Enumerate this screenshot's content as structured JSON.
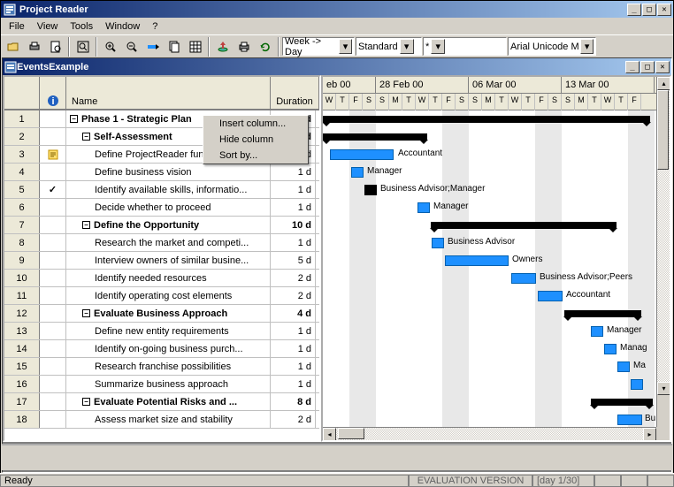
{
  "app": {
    "title": "Project Reader"
  },
  "menus": [
    "File",
    "View",
    "Tools",
    "Window",
    "?"
  ],
  "toolbar": {
    "zoom_combo": "Week -> Day",
    "layout_combo": "Standard",
    "filter_combo": "*",
    "font_combo": "Arial Unicode MS"
  },
  "doc": {
    "title": "EventsExample"
  },
  "columns": {
    "indicator": "",
    "name": "Name",
    "duration": "Duration"
  },
  "context_menu": [
    "Insert column...",
    "Hide column",
    "Sort by..."
  ],
  "timeline_weeks": [
    "eb 00",
    "28 Feb 00",
    "06 Mar 00",
    "13 Mar 00"
  ],
  "timeline_days": [
    "W",
    "T",
    "F",
    "S",
    "S",
    "M",
    "T",
    "W",
    "T",
    "F",
    "S",
    "S",
    "M",
    "T",
    "W",
    "T",
    "F",
    "S",
    "S",
    "M",
    "T",
    "W",
    "T",
    "F"
  ],
  "rows": [
    {
      "n": "1",
      "ind": "",
      "name": "Phase 1 - Strategic Plan",
      "dur": "3 d",
      "bold": true,
      "lvl": 0,
      "out": "-"
    },
    {
      "n": "2",
      "ind": "",
      "name": "Self-Assessment",
      "dur": "5 d",
      "bold": true,
      "lvl": 1,
      "out": "-"
    },
    {
      "n": "3",
      "ind": "note",
      "name": "Define ProjectReader functionalities",
      "dur": "5 d",
      "bold": false,
      "lvl": 2
    },
    {
      "n": "4",
      "ind": "",
      "name": "Define business vision",
      "dur": "1 d",
      "bold": false,
      "lvl": 2
    },
    {
      "n": "5",
      "ind": "check",
      "name": "Identify available skills, informatio...",
      "dur": "1 d",
      "bold": false,
      "lvl": 2
    },
    {
      "n": "6",
      "ind": "",
      "name": "Decide whether to proceed",
      "dur": "1 d",
      "bold": false,
      "lvl": 2
    },
    {
      "n": "7",
      "ind": "",
      "name": "Define the Opportunity",
      "dur": "10 d",
      "bold": true,
      "lvl": 1,
      "out": "-"
    },
    {
      "n": "8",
      "ind": "",
      "name": "Research the market and competi...",
      "dur": "1 d",
      "bold": false,
      "lvl": 2
    },
    {
      "n": "9",
      "ind": "",
      "name": "Interview owners of similar busine...",
      "dur": "5 d",
      "bold": false,
      "lvl": 2
    },
    {
      "n": "10",
      "ind": "",
      "name": "Identify needed resources",
      "dur": "2 d",
      "bold": false,
      "lvl": 2
    },
    {
      "n": "11",
      "ind": "",
      "name": "Identify operating cost elements",
      "dur": "2 d",
      "bold": false,
      "lvl": 2
    },
    {
      "n": "12",
      "ind": "",
      "name": "Evaluate Business Approach",
      "dur": "4 d",
      "bold": true,
      "lvl": 1,
      "out": "-"
    },
    {
      "n": "13",
      "ind": "",
      "name": "Define new entity requirements",
      "dur": "1 d",
      "bold": false,
      "lvl": 2
    },
    {
      "n": "14",
      "ind": "",
      "name": "Identify on-going business purch...",
      "dur": "1 d",
      "bold": false,
      "lvl": 2
    },
    {
      "n": "15",
      "ind": "",
      "name": "Research franchise possibilities",
      "dur": "1 d",
      "bold": false,
      "lvl": 2
    },
    {
      "n": "16",
      "ind": "",
      "name": "Summarize business approach",
      "dur": "1 d",
      "bold": false,
      "lvl": 2
    },
    {
      "n": "17",
      "ind": "",
      "name": "Evaluate Potential Risks and ...",
      "dur": "8 d",
      "bold": true,
      "lvl": 1,
      "out": "-"
    },
    {
      "n": "18",
      "ind": "",
      "name": "Assess market size and stability",
      "dur": "2 d",
      "bold": false,
      "lvl": 2
    }
  ],
  "gantt_labels": {
    "r3": "Accountant",
    "r4": "Manager",
    "r5": "Business Advisor;Manager",
    "r6": "Manager",
    "r8": "Business Advisor",
    "r9": "Owners",
    "r10": "Business Advisor;Peers",
    "r11": "Accountant",
    "r13": "Manager",
    "r14": "Manag",
    "r15": "Ma",
    "r18": "Bu"
  },
  "status": {
    "left": "Ready",
    "mid": "EVALUATION VERSION",
    "right": "[day 1/30]"
  }
}
